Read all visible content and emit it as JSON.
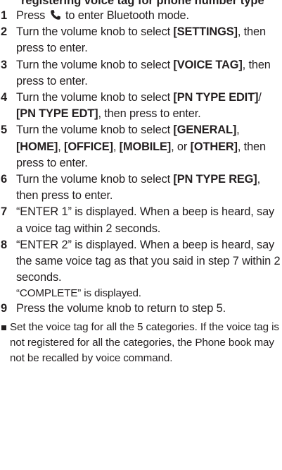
{
  "header": {
    "cut_line": "registering voice tag for phone number type"
  },
  "steps": [
    {
      "num": "1",
      "pre": "Press",
      "icon": "phone-icon",
      "post": "to enter Bluetooth mode."
    },
    {
      "num": "2",
      "a": "Turn the volume knob to select",
      "b": "[SETTINGS]",
      "c": ", then press to enter."
    },
    {
      "num": "3",
      "a": "Turn the volume knob to select",
      "b": "[VOICE TAG]",
      "c": ", then press to enter."
    },
    {
      "num": "4",
      "a": "Turn the volume knob to select",
      "b": "[PN TYPE EDIT]",
      "c": "/",
      "d": "[PN TYPE EDT]",
      "e": ", then press to enter."
    },
    {
      "num": "5",
      "a": "Turn the volume knob to select",
      "b": "[GENERAL]",
      "c": ",",
      "d": "[HOME]",
      "e": ",",
      "f": "[OFFICE]",
      "g": ",",
      "h": "[MOBILE]",
      "i": ", or",
      "j": "[OTHER]",
      "k": ", then press to enter."
    },
    {
      "num": "6",
      "a": "Turn the volume knob to select",
      "b": "[PN TYPE REG]",
      "c": ", then press to enter."
    },
    {
      "num": "7",
      "a": "“ENTER 1” is displayed. When a beep is heard, say a voice tag within 2 seconds."
    },
    {
      "num": "8",
      "a": "“ENTER 2” is displayed. When a beep is heard, say the same voice tag as that you said in step 7 within 2 seconds.",
      "note": "“COMPLETE” is displayed."
    },
    {
      "num": "9",
      "a": "Press the volume knob to return to step 5."
    }
  ],
  "bullet_note": "Set the voice tag for all the 5 categories.  If the voice tag is not registered for all the categories, the Phone book may not be recalled by voice command.",
  "colors": {
    "text": "#231f20"
  }
}
